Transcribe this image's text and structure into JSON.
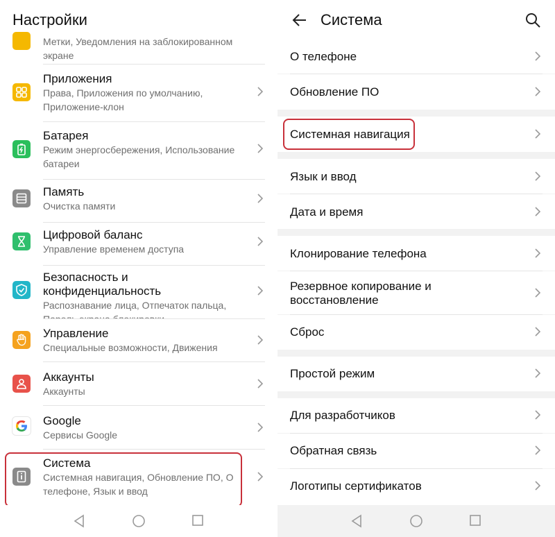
{
  "left": {
    "title": "Настройки",
    "top_partial": {
      "subtitle_line1": "Метки, Уведомления на заблокированном",
      "subtitle_line2": "экране"
    },
    "items": [
      {
        "title": "Приложения",
        "sub1": "Права, Приложения по умолчанию,",
        "sub2": "Приложение-клон",
        "icon": "apps-icon",
        "color": "#f5b800"
      },
      {
        "title": "Батарея",
        "sub1": "Режим энергосбережения, Использование",
        "sub2": "батареи",
        "icon": "battery-icon",
        "color": "#2bbf5c"
      },
      {
        "title": "Память",
        "sub1": "Очистка памяти",
        "sub2": "",
        "icon": "storage-icon",
        "color": "#8a8a8a"
      },
      {
        "title": "Цифровой баланс",
        "sub1": "Управление временем доступа",
        "sub2": "",
        "icon": "hourglass-icon",
        "color": "#2fbf6d"
      },
      {
        "title": "Безопасность и конфиденциальность",
        "sub1": "Распознавание лица, Отпечаток пальца,",
        "sub2": "Пароль экрана блокировки",
        "icon": "shield-icon",
        "color": "#22b6c8"
      },
      {
        "title": "Управление",
        "sub1": "Специальные возможности, Движения",
        "sub2": "",
        "icon": "hand-icon",
        "color": "#f5a21e"
      },
      {
        "title": "Аккаунты",
        "sub1": "Аккаунты",
        "sub2": "",
        "icon": "account-icon",
        "color": "#e8524a"
      },
      {
        "title": "Google",
        "sub1": "Сервисы Google",
        "sub2": "",
        "icon": "google-icon",
        "color": "#ffffff"
      },
      {
        "title": "Система",
        "sub1": "Системная навигация, Обновление ПО, О",
        "sub2": "телефоне, Язык и ввод",
        "icon": "info-icon",
        "color": "#8a8a8a"
      }
    ]
  },
  "right": {
    "title": "Система",
    "groups": [
      [
        "О телефоне",
        "Обновление ПО"
      ],
      [
        "Системная навигация"
      ],
      [
        "Язык и ввод",
        "Дата и время"
      ],
      [
        "Клонирование телефона",
        "Резервное копирование и\nвосстановление",
        "Сброс"
      ],
      [
        "Простой режим"
      ],
      [
        "Для разработчиков",
        "Обратная связь",
        "Логотипы сертификатов"
      ]
    ],
    "items": {
      "about": "О телефоне",
      "update": "Обновление ПО",
      "sysnav": "Системная навигация",
      "lang": "Язык и ввод",
      "datetime": "Дата и время",
      "clone": "Клонирование телефона",
      "backup1": "Резервное копирование и",
      "backup2": "восстановление",
      "reset": "Сброс",
      "simple": "Простой режим",
      "dev": "Для разработчиков",
      "feedback": "Обратная связь",
      "certs": "Логотипы сертификатов"
    }
  },
  "colors": {
    "highlight": "#c8303a",
    "separator": "#e4e4e4",
    "group_gap": "#f2f2f2"
  }
}
